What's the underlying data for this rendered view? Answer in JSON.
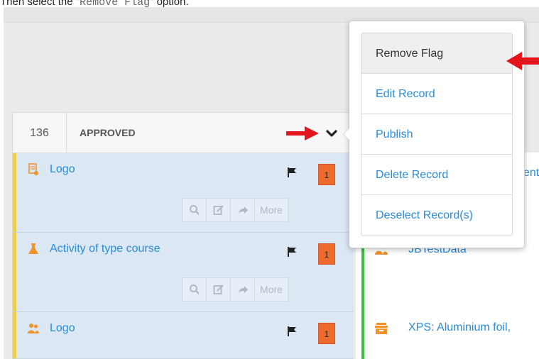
{
  "instruction": {
    "prefix": "Then select the \"",
    "code": "Remove Flag",
    "suffix": "\" option."
  },
  "header": {
    "count": "136",
    "status": "APPROVED"
  },
  "records": [
    {
      "title": "Logo",
      "icon": "document-icon",
      "badge": "1",
      "more_label": "More"
    },
    {
      "title": "Activity of type course",
      "icon": "flask-icon",
      "badge": "1",
      "more_label": "More"
    },
    {
      "title": "Logo",
      "icon": "users-icon",
      "badge": "1",
      "more_label": "More"
    }
  ],
  "right_records": [
    {
      "title": "ent"
    },
    {
      "title": "JBTestData",
      "icon": "users-icon"
    },
    {
      "title": "XPS: Aluminium foil,",
      "icon": "product-box-icon"
    }
  ],
  "menu": {
    "items": [
      {
        "label": "Remove Flag",
        "active": true
      },
      {
        "label": "Edit Record"
      },
      {
        "label": "Publish"
      },
      {
        "label": "Delete Record"
      },
      {
        "label": "Deselect Record(s)"
      }
    ]
  },
  "colors": {
    "link": "#2a8bd6",
    "row_bg": "#dbe7f3",
    "yellow_bar": "#e9cf4d",
    "green_bar": "#3bc23b",
    "badge": "#ef6a2d",
    "annotation_arrow": "#e3141b"
  }
}
